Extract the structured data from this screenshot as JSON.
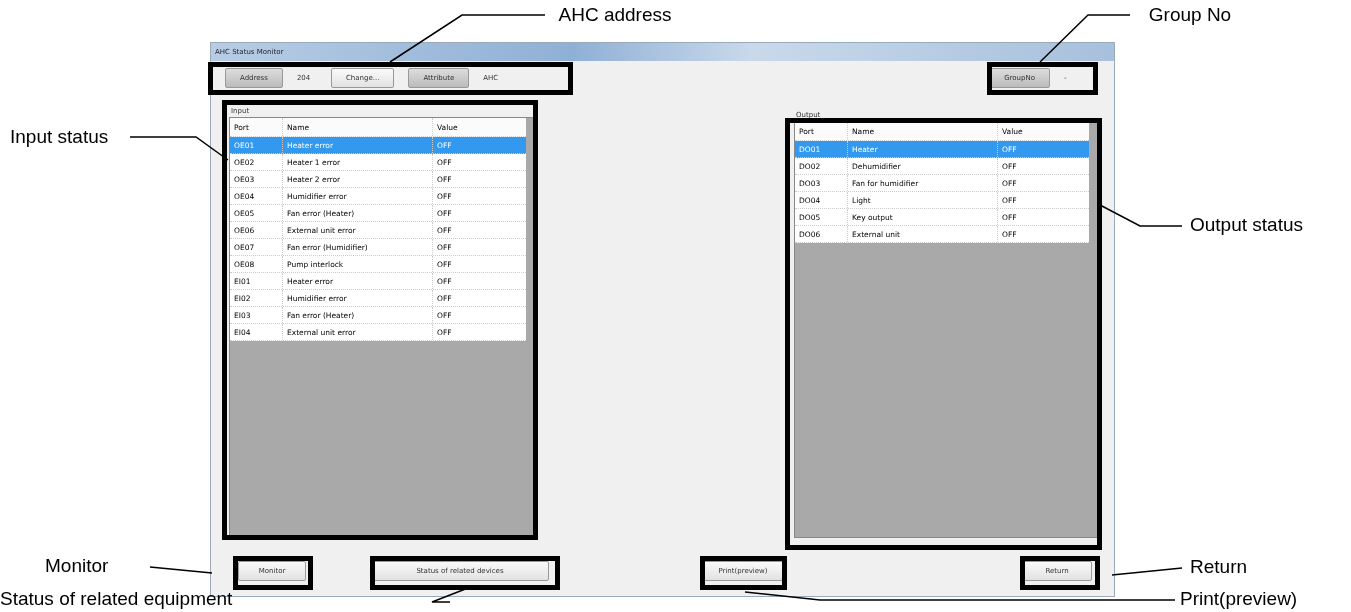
{
  "callouts": [
    {
      "text": "AHC address"
    },
    {
      "text": "Group No"
    },
    {
      "text": "Input status"
    },
    {
      "text": "Output status"
    },
    {
      "text": "Monitor"
    },
    {
      "text": "Return"
    },
    {
      "text": "Status of related equipment"
    },
    {
      "text": "Print(preview)"
    }
  ],
  "window": {
    "title": "AHC Status Monitor"
  },
  "toolbar": {
    "address_button": "Address",
    "address_value": "204",
    "change_button": "Change...",
    "attribute_button": "Attribute",
    "attribute_value": "AHC",
    "group_button": "GroupNo",
    "group_value": "-"
  },
  "input": {
    "label": "Input",
    "columns": [
      "Port",
      "Name",
      "Value"
    ],
    "rows": [
      {
        "port": "OE01",
        "name": "Heater error",
        "value": "OFF",
        "selected": true
      },
      {
        "port": "OE02",
        "name": "Heater 1 error",
        "value": "OFF",
        "selected": false
      },
      {
        "port": "OE03",
        "name": "Heater 2 error",
        "value": "OFF",
        "selected": false
      },
      {
        "port": "OE04",
        "name": "Humidifier error",
        "value": "OFF",
        "selected": false
      },
      {
        "port": "OE05",
        "name": "Fan error (Heater)",
        "value": "OFF",
        "selected": false
      },
      {
        "port": "OE06",
        "name": "External unit error",
        "value": "OFF",
        "selected": false
      },
      {
        "port": "OE07",
        "name": "Fan error (Humidifier)",
        "value": "OFF",
        "selected": false
      },
      {
        "port": "OE08",
        "name": "Pump interlock",
        "value": "OFF",
        "selected": false
      },
      {
        "port": "EI01",
        "name": "Heater error",
        "value": "OFF",
        "selected": false
      },
      {
        "port": "EI02",
        "name": "Humidifier error",
        "value": "OFF",
        "selected": false
      },
      {
        "port": "EI03",
        "name": "Fan error (Heater)",
        "value": "OFF",
        "selected": false
      },
      {
        "port": "EI04",
        "name": "External unit error",
        "value": "OFF",
        "selected": false
      }
    ]
  },
  "output": {
    "label": "Output",
    "columns": [
      "Port",
      "Name",
      "Value"
    ],
    "rows": [
      {
        "port": "DO01",
        "name": "Heater",
        "value": "OFF",
        "selected": true
      },
      {
        "port": "DO02",
        "name": "Dehumidifier",
        "value": "OFF",
        "selected": false
      },
      {
        "port": "DO03",
        "name": "Fan for humidifier",
        "value": "OFF",
        "selected": false
      },
      {
        "port": "DO04",
        "name": "Light",
        "value": "OFF",
        "selected": false
      },
      {
        "port": "DO05",
        "name": "Key output",
        "value": "OFF",
        "selected": false
      },
      {
        "port": "DO06",
        "name": "External unit",
        "value": "OFF",
        "selected": false
      }
    ]
  },
  "buttons": {
    "monitor": "Monitor",
    "related": "Status of related devices",
    "print": "Print(preview)",
    "return": "Return"
  }
}
